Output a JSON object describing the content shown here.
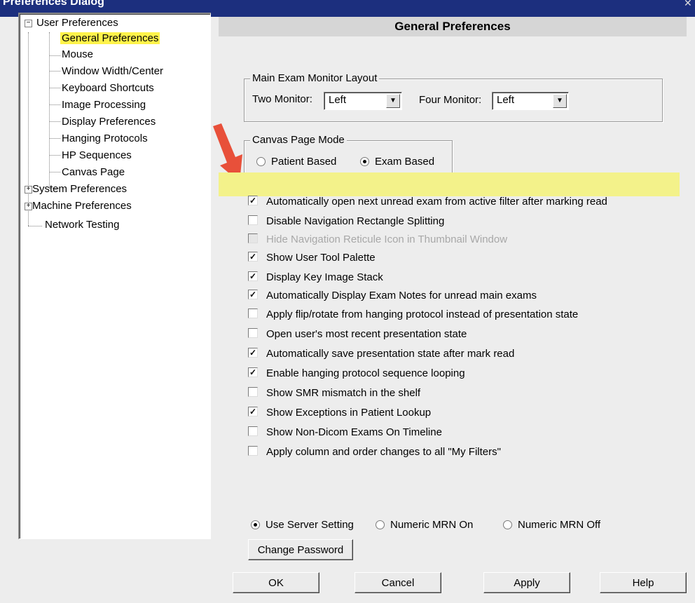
{
  "window": {
    "title": "Preferences Dialog",
    "close_glyph": "✕"
  },
  "tree": {
    "items": [
      {
        "label": "User Preferences",
        "expander": "−",
        "level": 0,
        "highlighted": false
      },
      {
        "label": "General Preferences",
        "level": 1,
        "highlighted": true
      },
      {
        "label": "Mouse",
        "level": 1,
        "highlighted": false
      },
      {
        "label": "Window Width/Center",
        "level": 1,
        "highlighted": false
      },
      {
        "label": "Keyboard Shortcuts",
        "level": 1,
        "highlighted": false
      },
      {
        "label": "Image Processing",
        "level": 1,
        "highlighted": false
      },
      {
        "label": "Display Preferences",
        "level": 1,
        "highlighted": false
      },
      {
        "label": "Hanging Protocols",
        "level": 1,
        "highlighted": false
      },
      {
        "label": "HP Sequences",
        "level": 1,
        "highlighted": false
      },
      {
        "label": "Canvas Page",
        "level": 1,
        "highlighted": false
      },
      {
        "label": "System Preferences",
        "expander": "+",
        "level": 0,
        "highlighted": false
      },
      {
        "label": "Machine Preferences",
        "expander": "+",
        "level": 0,
        "highlighted": false
      },
      {
        "label": "Network Testing",
        "level": 0,
        "highlighted": false
      }
    ]
  },
  "panel": {
    "header": "General Preferences",
    "monitor_layout": {
      "legend": "Main Exam Monitor Layout",
      "two_label": "Two Monitor:",
      "two_value": "Left",
      "four_label": "Four Monitor:",
      "four_value": "Left",
      "arrow_glyph": "▼"
    },
    "canvas_mode": {
      "legend": "Canvas Page Mode",
      "patient_label": "Patient Based",
      "exam_label": "Exam Based",
      "selected": "exam"
    },
    "checkboxes": [
      {
        "label": "Automatically open next unread exam from active filter after marking read",
        "checked": true,
        "disabled": false
      },
      {
        "label": "Disable Navigation Rectangle Splitting",
        "checked": false,
        "disabled": false
      },
      {
        "label": "Hide Navigation Reticule Icon in Thumbnail Window",
        "checked": false,
        "disabled": true
      },
      {
        "label": "Show User Tool Palette",
        "checked": true,
        "disabled": false
      },
      {
        "label": "Display Key Image Stack",
        "checked": true,
        "disabled": false
      },
      {
        "label": "Automatically Display Exam Notes for unread main exams",
        "checked": true,
        "disabled": false
      },
      {
        "label": "Apply flip/rotate from hanging protocol instead of presentation state",
        "checked": false,
        "disabled": false
      },
      {
        "label": "Open user's most recent presentation state",
        "checked": false,
        "disabled": false
      },
      {
        "label": "Automatically save presentation state after mark read",
        "checked": true,
        "disabled": false
      },
      {
        "label": "Enable hanging protocol sequence looping",
        "checked": true,
        "disabled": false
      },
      {
        "label": "Show SMR mismatch in the shelf",
        "checked": false,
        "disabled": false
      },
      {
        "label": "Show Exceptions in Patient Lookup",
        "checked": true,
        "disabled": false
      },
      {
        "label": "Show Non-Dicom Exams On Timeline",
        "checked": false,
        "disabled": false
      },
      {
        "label": "Apply column and order changes to all \"My Filters\"",
        "checked": false,
        "disabled": false
      }
    ],
    "mrn": {
      "server_label": "Use Server Setting",
      "on_label": "Numeric MRN On",
      "off_label": "Numeric MRN Off",
      "selected": "server"
    },
    "change_password": "Change Password"
  },
  "buttons": {
    "ok": "OK",
    "cancel": "Cancel",
    "apply": "Apply",
    "help": "Help"
  },
  "colors": {
    "title_bar": "#1c2f7e",
    "highlight": "#fff34a",
    "annotation_arrow": "#e8503a"
  }
}
